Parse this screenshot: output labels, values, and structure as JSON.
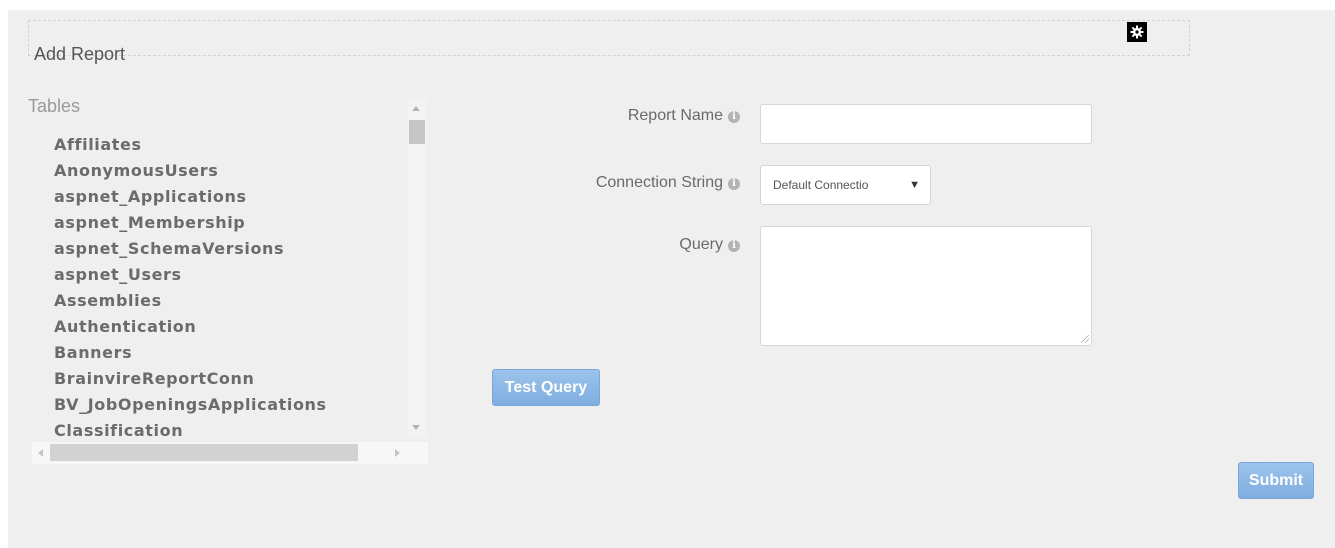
{
  "page": {
    "title": "Add Report"
  },
  "tables": {
    "label": "Tables",
    "items": [
      "Affiliates",
      "AnonymousUsers",
      "aspnet_Applications",
      "aspnet_Membership",
      "aspnet_SchemaVersions",
      "aspnet_Users",
      "Assemblies",
      "Authentication",
      "Banners",
      "BrainvireReportConn",
      "BV_JobOpeningsApplications",
      "Classification"
    ]
  },
  "form": {
    "report_name": {
      "label": "Report Name",
      "value": ""
    },
    "connection_string": {
      "label": "Connection String",
      "selected": "Default Connectio"
    },
    "query": {
      "label": "Query",
      "value": ""
    },
    "info_glyph": "i"
  },
  "buttons": {
    "test_query": "Test Query",
    "submit": "Submit"
  },
  "icons": {
    "settings": "gear-icon",
    "info": "info-icon"
  },
  "colors": {
    "button_blue": "#8ab6e6",
    "panel_bg": "#efefef"
  }
}
